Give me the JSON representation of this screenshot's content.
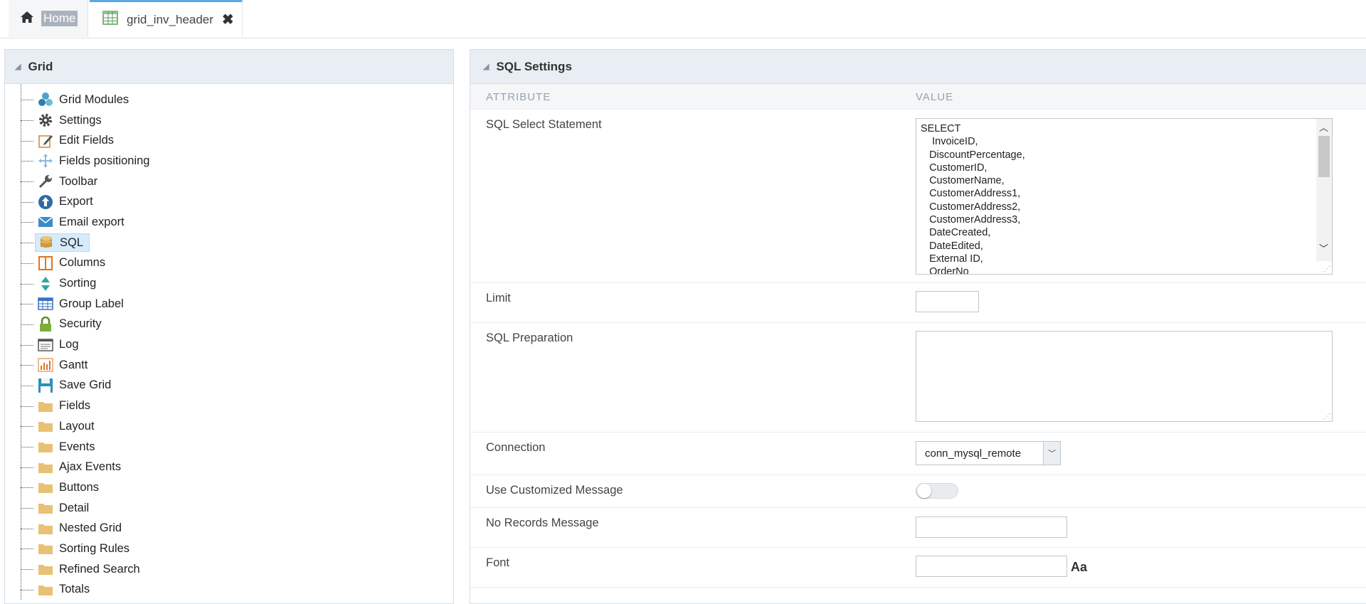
{
  "tabs": {
    "home": {
      "label": "Home",
      "icon": "home-icon"
    },
    "grid": {
      "label": "grid_inv_header",
      "icon": "grid-table-icon",
      "close": "✖"
    }
  },
  "left_panel": {
    "title": "Grid",
    "items": [
      {
        "label": "Grid Modules",
        "icon": "grid-modules-icon"
      },
      {
        "label": "Settings",
        "icon": "gear-icon"
      },
      {
        "label": "Edit Fields",
        "icon": "edit-icon"
      },
      {
        "label": "Fields positioning",
        "icon": "move-arrows-icon"
      },
      {
        "label": "Toolbar",
        "icon": "wrench-icon"
      },
      {
        "label": "Export",
        "icon": "export-icon"
      },
      {
        "label": "Email export",
        "icon": "envelope-icon"
      },
      {
        "label": "SQL",
        "icon": "database-icon",
        "selected": true
      },
      {
        "label": "Columns",
        "icon": "columns-icon"
      },
      {
        "label": "Sorting",
        "icon": "sort-icon"
      },
      {
        "label": "Group Label",
        "icon": "table-icon"
      },
      {
        "label": "Security",
        "icon": "lock-icon"
      },
      {
        "label": "Log",
        "icon": "log-icon"
      },
      {
        "label": "Gantt",
        "icon": "gantt-chart-icon"
      },
      {
        "label": "Save Grid",
        "icon": "save-icon"
      },
      {
        "label": "Fields",
        "icon": "folder-icon"
      },
      {
        "label": "Layout",
        "icon": "folder-icon"
      },
      {
        "label": "Events",
        "icon": "folder-icon"
      },
      {
        "label": "Ajax Events",
        "icon": "folder-icon"
      },
      {
        "label": "Buttons",
        "icon": "folder-icon"
      },
      {
        "label": "Detail",
        "icon": "folder-icon"
      },
      {
        "label": "Nested Grid",
        "icon": "folder-icon"
      },
      {
        "label": "Sorting Rules",
        "icon": "folder-icon"
      },
      {
        "label": "Refined Search",
        "icon": "folder-icon"
      },
      {
        "label": "Totals",
        "icon": "folder-icon"
      }
    ]
  },
  "right_panel": {
    "title": "SQL Settings",
    "col_attribute": "ATTRIBUTE",
    "col_value": "VALUE",
    "sql_label": "SQL Select Statement",
    "sql_value": "SELECT\n    InvoiceID,\n   DiscountPercentage,\n   CustomerID,\n   CustomerName,\n   CustomerAddress1,\n   CustomerAddress2,\n   CustomerAddress3,\n   DateCreated,\n   DateEdited,\n   External ID,\n   OrderNo",
    "limit_label": "Limit",
    "limit_value": "",
    "prep_label": "SQL Preparation",
    "prep_value": "",
    "connection_label": "Connection",
    "connection_value": "conn_mysql_remote",
    "custom_msg_label": "Use Customized Message",
    "custom_msg_on": false,
    "no_records_label": "No Records Message",
    "no_records_value": "",
    "font_label": "Font",
    "font_value": "",
    "font_icon_text": "Aa"
  }
}
